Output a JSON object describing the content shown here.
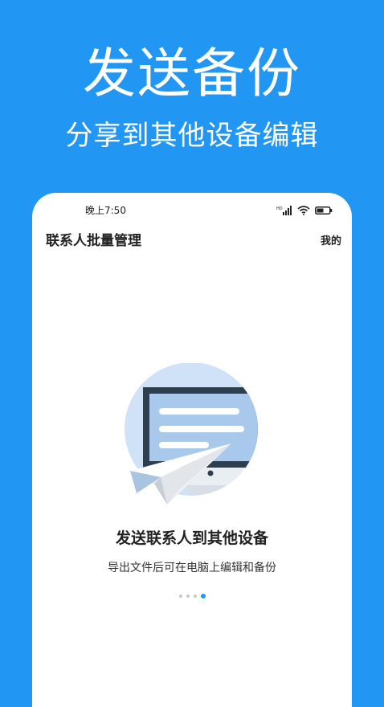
{
  "promo": {
    "title": "发送备份",
    "subtitle": "分享到其他设备编辑"
  },
  "status_bar": {
    "time": "晚上7:50",
    "network": "HD"
  },
  "header": {
    "title": "联系人批量管理",
    "mine_label": "我的"
  },
  "feature": {
    "title": "发送联系人到其他设备",
    "description": "导出文件后可在电脑上编辑和备份"
  },
  "pager": {
    "total": 4,
    "active_index": 3
  },
  "colors": {
    "accent": "#2196f3",
    "illustration_bg": "#cfe2f7"
  },
  "icons": [
    "signal-icon",
    "wifi-icon",
    "battery-icon",
    "monitor-icon",
    "paper-plane-icon"
  ]
}
